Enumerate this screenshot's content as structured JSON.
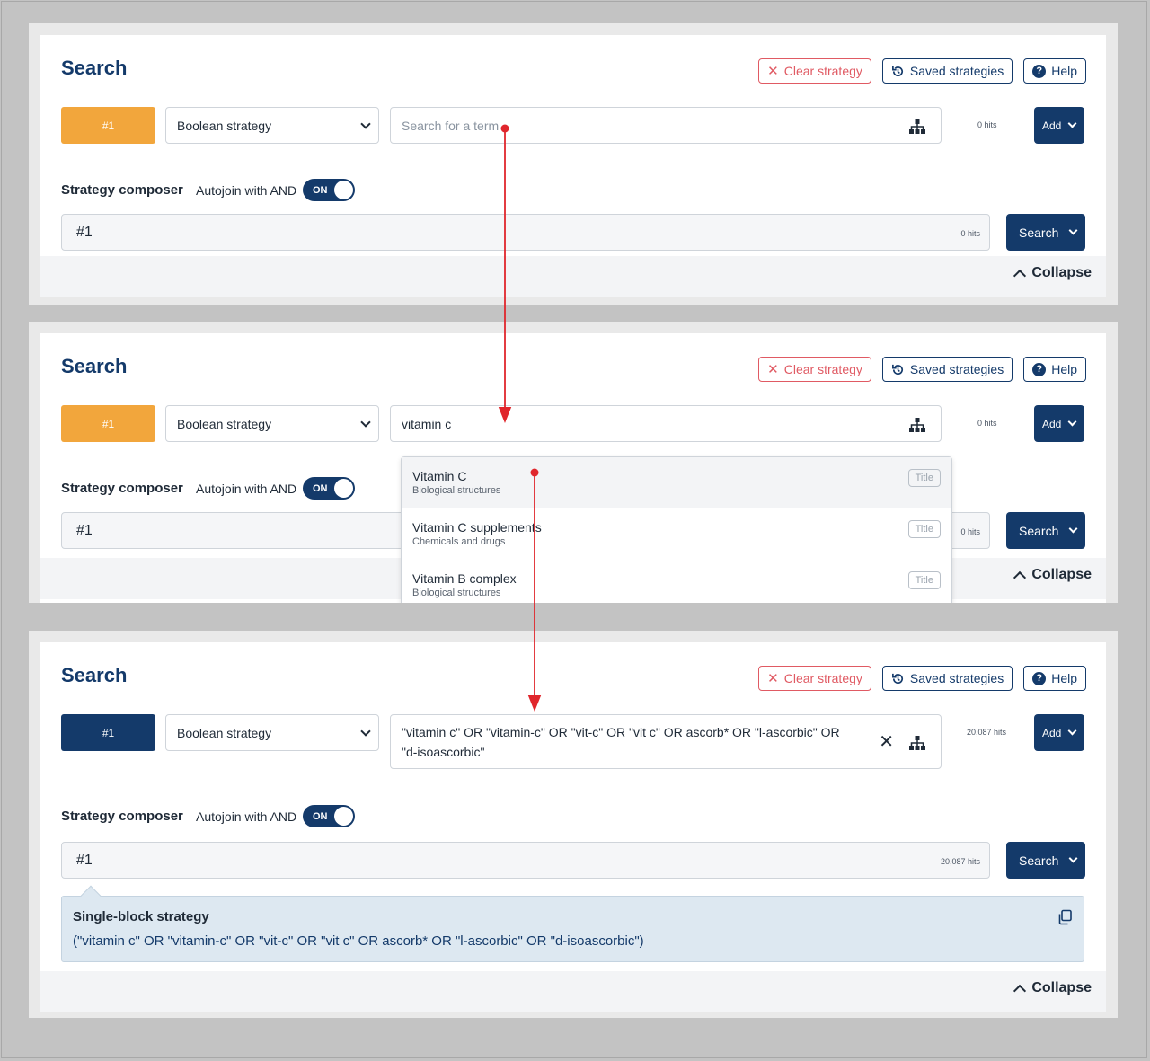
{
  "common": {
    "title": "Search",
    "clear_label": "Clear strategy",
    "saved_label": "Saved strategies",
    "help_label": "Help",
    "help_glyph": "?",
    "block_label": "#1",
    "strategy_select": "Boolean strategy",
    "add_label": "Add",
    "composer_label": "Strategy composer",
    "autojoin_label": "Autojoin with AND",
    "toggle_label": "ON",
    "composer_value": "#1",
    "search_label": "Search",
    "collapse_label": "Collapse"
  },
  "panel1": {
    "search_placeholder": "Search for a term",
    "hits": "0 hits",
    "composer_hits": "0 hits"
  },
  "panel2": {
    "search_value": "vitamin c",
    "hits": "0 hits",
    "composer_hits": "0 hits",
    "suggestions": [
      {
        "title": "Vitamin C",
        "category": "Biological structures",
        "badge": "Title"
      },
      {
        "title": "Vitamin C supplements",
        "category": "Chemicals and drugs",
        "badge": "Title"
      },
      {
        "title": "Vitamin B complex",
        "category": "Biological structures",
        "badge": "Title"
      }
    ]
  },
  "panel3": {
    "search_value": "\"vitamin c\" OR \"vitamin-c\" OR \"vit-c\" OR \"vit c\" OR ascorb* OR \"l-ascorbic\" OR \"d-isoascorbic\"",
    "hits": "20,087 hits",
    "composer_hits": "20,087 hits",
    "strategy_title": "Single-block strategy",
    "strategy_text": "(\"vitamin c\" OR \"vitamin-c\" OR \"vit-c\" OR \"vit c\" OR ascorb* OR \"l-ascorbic\" OR \"d-isoascorbic\")"
  },
  "colors": {
    "navy": "#143a6a",
    "orange": "#f2a63c",
    "red": "#e05a63",
    "arrow": "#e0262c"
  }
}
